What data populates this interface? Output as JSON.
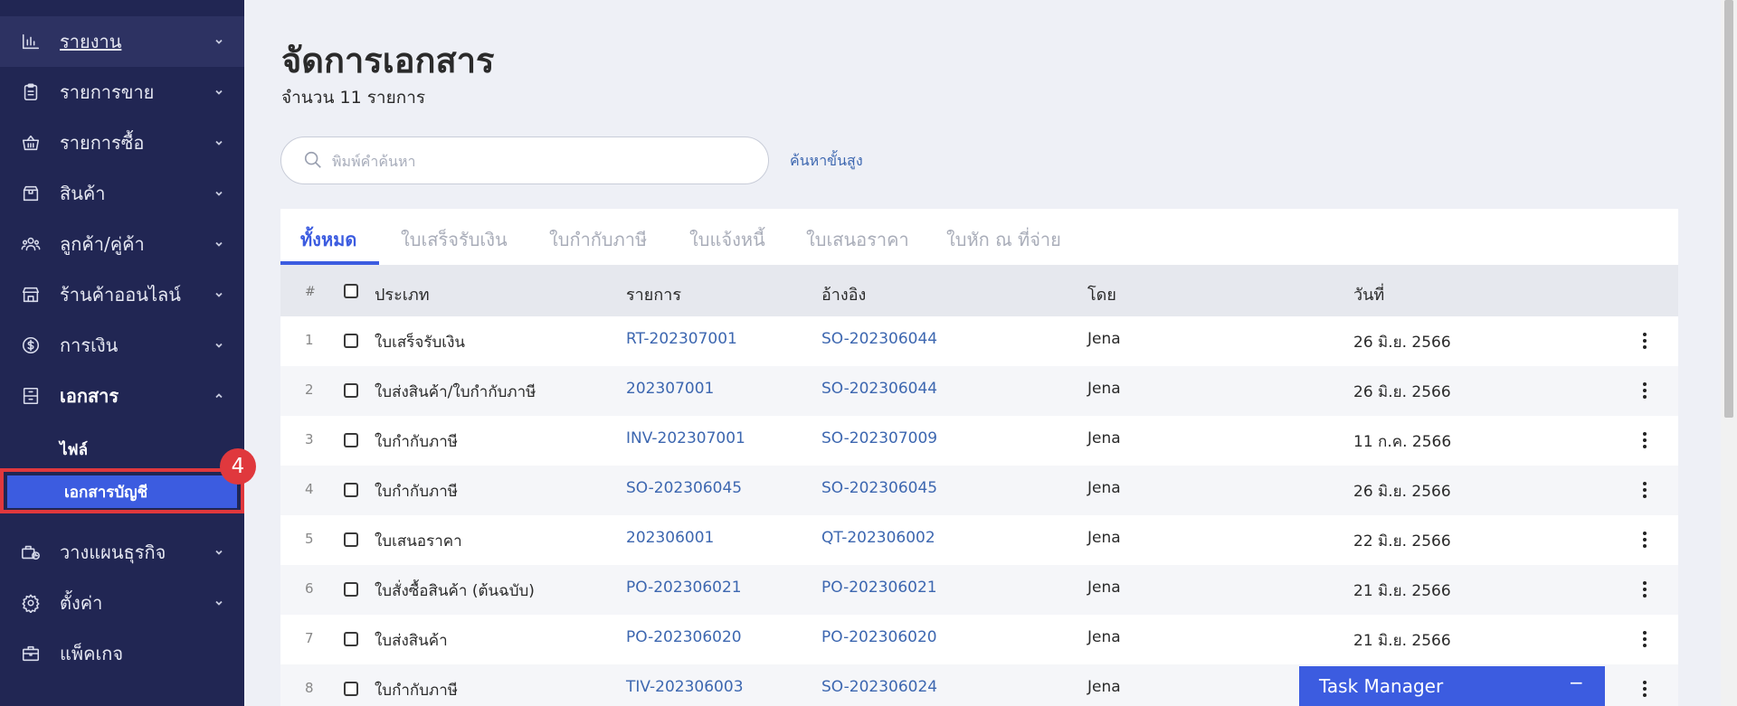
{
  "sidebar": {
    "items": [
      {
        "label": "รายงาน",
        "icon": "bar-chart-icon"
      },
      {
        "label": "รายการขาย",
        "icon": "clipboard-icon"
      },
      {
        "label": "รายการซื้อ",
        "icon": "basket-icon"
      },
      {
        "label": "สินค้า",
        "icon": "box-icon"
      },
      {
        "label": "ลูกค้า/คู่ค้า",
        "icon": "users-icon"
      },
      {
        "label": "ร้านค้าออนไลน์",
        "icon": "store-icon"
      },
      {
        "label": "การเงิน",
        "icon": "dollar-circle-icon"
      },
      {
        "label": "เอกสาร",
        "icon": "document-icon"
      },
      {
        "label": "วางแผนธุรกิจ",
        "icon": "briefcase-chart-icon"
      },
      {
        "label": "ตั้งค่า",
        "icon": "gear-icon"
      },
      {
        "label": "แพ็คเกจ",
        "icon": "package-icon"
      }
    ],
    "sub_items": [
      {
        "label": "ไฟล์"
      },
      {
        "label": "เอกสารบัญชี"
      }
    ],
    "step_badge": "4"
  },
  "main": {
    "title": "จัดการเอกสาร",
    "count_text": "จำนวน 11 รายการ",
    "search": {
      "placeholder": "พิมพ์คำค้นหา"
    },
    "advanced_search": "ค้นหาขั้นสูง",
    "tabs": [
      {
        "label": "ทั้งหมด",
        "active": true
      },
      {
        "label": "ใบเสร็จรับเงิน"
      },
      {
        "label": "ใบกำกับภาษี"
      },
      {
        "label": "ใบแจ้งหนี้"
      },
      {
        "label": "ใบเสนอราคา"
      },
      {
        "label": "ใบหัก ณ ที่จ่าย"
      }
    ],
    "table": {
      "headers": {
        "hash": "#",
        "type": "ประเภท",
        "item": "รายการ",
        "ref": "อ้างอิง",
        "by": "โดย",
        "date": "วันที่"
      },
      "rows": [
        {
          "n": "1",
          "type": "ใบเสร็จรับเงิน",
          "item": "RT-202307001",
          "ref": "SO-202306044",
          "by": "Jena",
          "date": "26 มิ.ย. 2566"
        },
        {
          "n": "2",
          "type": "ใบส่งสินค้า/ใบกำกับภาษี",
          "item": "202307001",
          "ref": "SO-202306044",
          "by": "Jena",
          "date": "26 มิ.ย. 2566"
        },
        {
          "n": "3",
          "type": "ใบกำกับภาษี",
          "item": "INV-202307001",
          "ref": "SO-202307009",
          "by": "Jena",
          "date": "11 ก.ค. 2566"
        },
        {
          "n": "4",
          "type": "ใบกำกับภาษี",
          "item": "SO-202306045",
          "ref": "SO-202306045",
          "by": "Jena",
          "date": "26 มิ.ย. 2566"
        },
        {
          "n": "5",
          "type": "ใบเสนอราคา",
          "item": "202306001",
          "ref": "QT-202306002",
          "by": "Jena",
          "date": "22 มิ.ย. 2566"
        },
        {
          "n": "6",
          "type": "ใบสั่งซื้อสินค้า (ต้นฉบับ)",
          "item": "PO-202306021",
          "ref": "PO-202306021",
          "by": "Jena",
          "date": "21 มิ.ย. 2566"
        },
        {
          "n": "7",
          "type": "ใบส่งสินค้า",
          "item": "PO-202306020",
          "ref": "PO-202306020",
          "by": "Jena",
          "date": "21 มิ.ย. 2566"
        },
        {
          "n": "8",
          "type": "ใบกำกับภาษี",
          "item": "TIV-202306003",
          "ref": "SO-202306024",
          "by": "Jena",
          "date": ""
        }
      ]
    }
  },
  "task_manager": {
    "title": "Task Manager",
    "minimize": "−"
  },
  "colors": {
    "sidebar": "#212653",
    "accent": "#3c5ce0",
    "highlight": "#e0383d",
    "link": "#3d67b0"
  }
}
